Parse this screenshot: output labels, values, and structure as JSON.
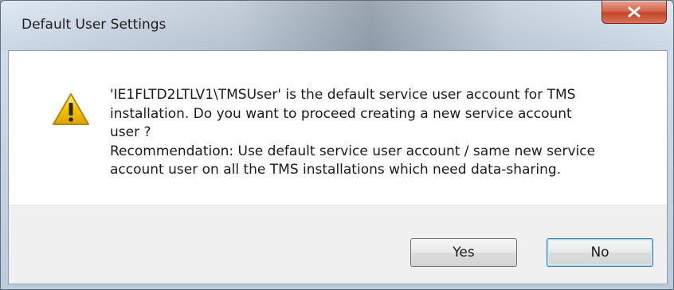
{
  "dialog": {
    "title": "Default User Settings",
    "close_icon": "close-icon",
    "warning_icon": "warning-icon",
    "message": {
      "line1": "'IE1FLTD2LTLV1\\TMSUser' is the default service user account for TMS",
      "line2": "installation. Do you want to proceed creating a new service account",
      "line3": "user ?",
      "line4": "Recommendation: Use default service user account / same new service",
      "line5": "account user on all the TMS installations which need data-sharing."
    },
    "buttons": {
      "yes_label": "Yes",
      "no_label": "No"
    },
    "colors": {
      "close_button": "#c4452a",
      "default_button_border": "#3c7fb1",
      "warning": "#f5c400"
    }
  }
}
